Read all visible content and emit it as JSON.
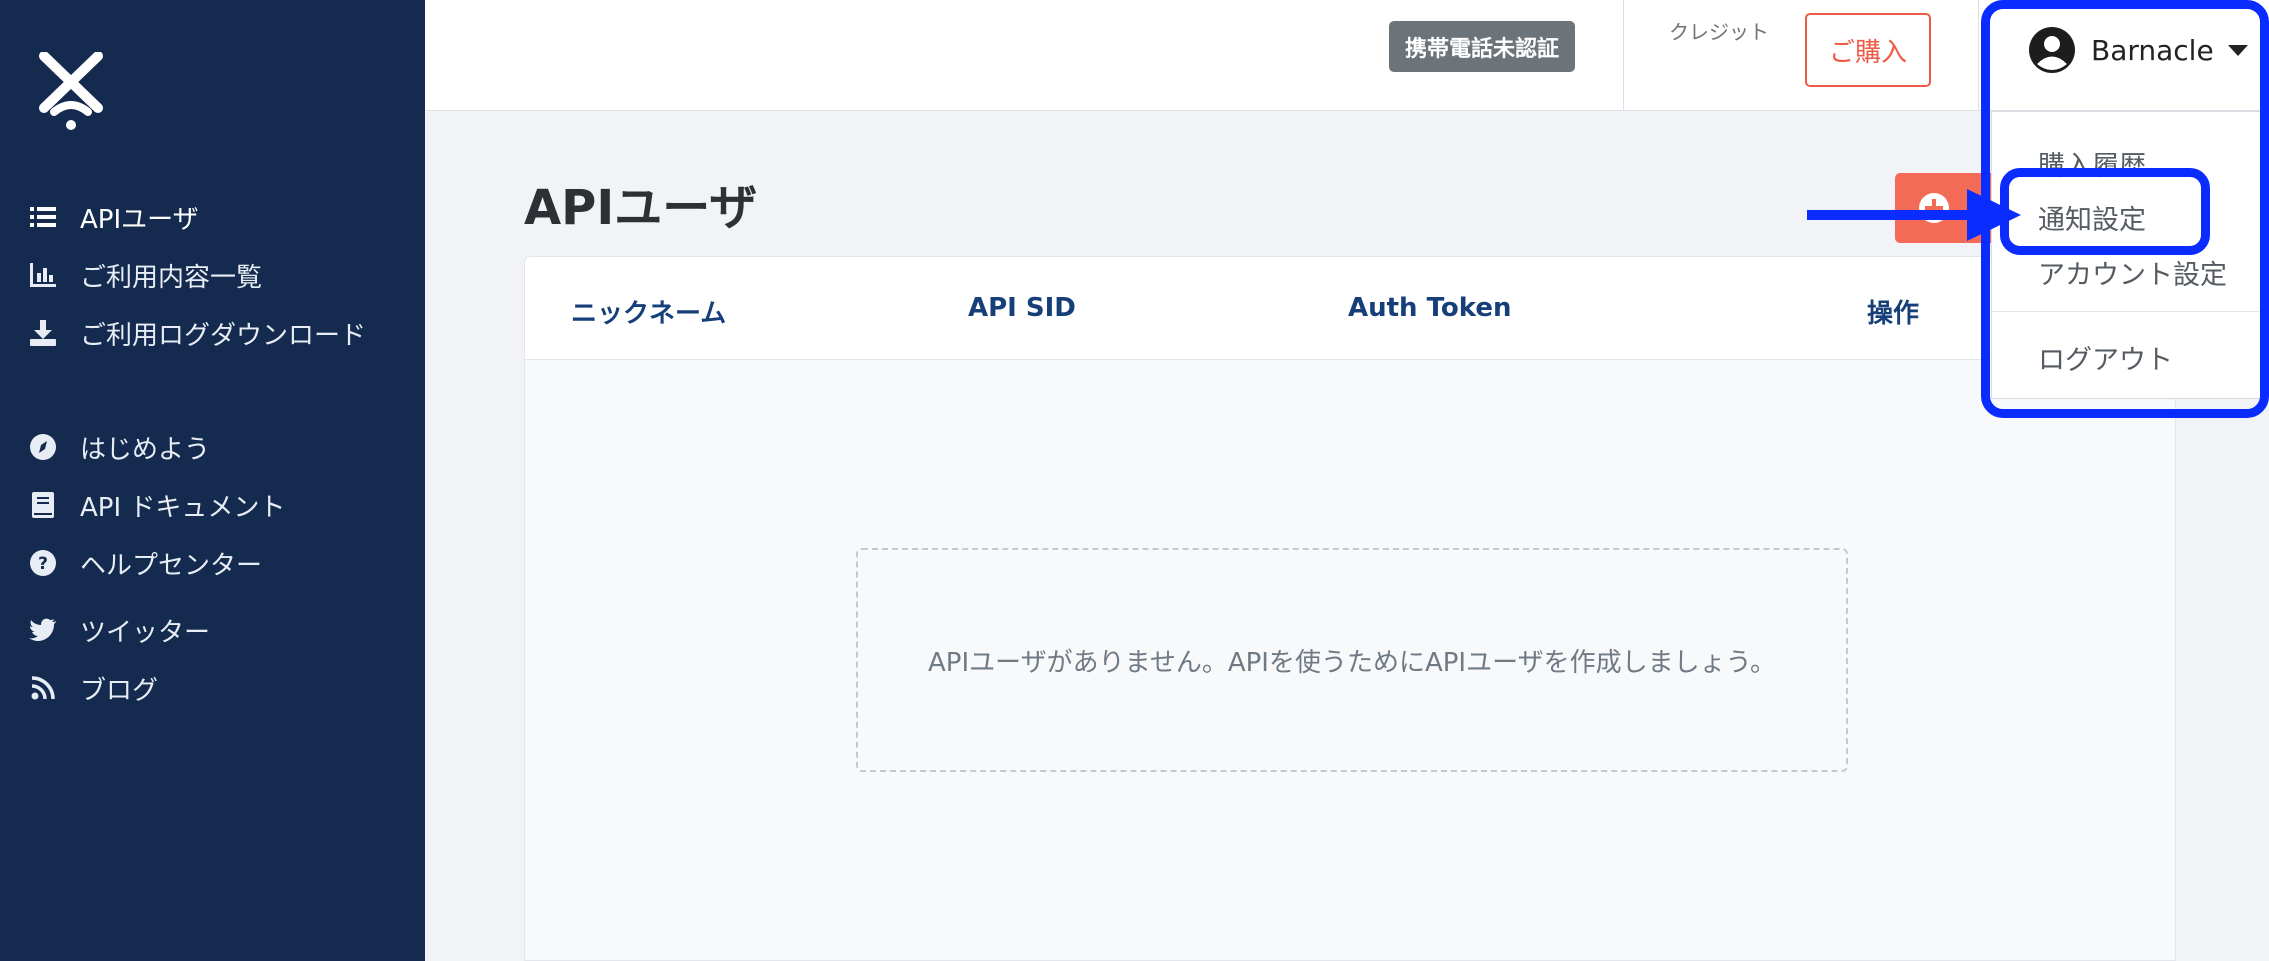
{
  "sidebar": {
    "items": [
      {
        "label": "APIユーザ",
        "icon": "list-icon"
      },
      {
        "label": "ご利用内容一覧",
        "icon": "bar-chart-icon"
      },
      {
        "label": "ご利用ログダウンロード",
        "icon": "download-icon"
      },
      {
        "label": "はじめよう",
        "icon": "compass-icon"
      },
      {
        "label": "API ドキュメント",
        "icon": "book-icon"
      },
      {
        "label": "ヘルプセンター",
        "icon": "question-circle-icon"
      },
      {
        "label": "ツイッター",
        "icon": "twitter-icon"
      },
      {
        "label": "ブログ",
        "icon": "rss-icon"
      }
    ]
  },
  "header": {
    "phone_badge": "携帯電話未認証",
    "credit_label": "クレジット",
    "buy_label": "ご購入",
    "user_name": "Barnacle"
  },
  "user_dropdown": {
    "items": [
      "購入履歴",
      "通知設定",
      "アカウント設定",
      "ログアウト"
    ]
  },
  "main": {
    "title": "APIユーザ",
    "table": {
      "columns": [
        "ニックネーム",
        "API SID",
        "Auth Token",
        "操作"
      ],
      "empty_message": "APIユーザがありません。APIを使うためにAPIユーザを作成しましょう。"
    }
  },
  "colors": {
    "sidebar_bg": "#142b4f",
    "accent": "#f36b56",
    "header_text": "#163f7a",
    "annotation": "#0a2cff"
  }
}
